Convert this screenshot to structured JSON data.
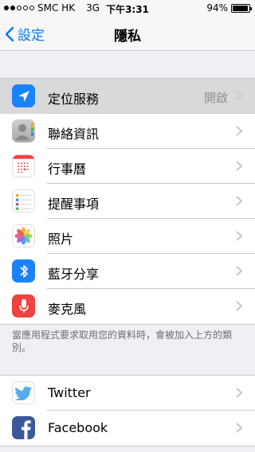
{
  "status_bar": {
    "carrier": "SMC HK",
    "network": "3G",
    "time": "下午3:31",
    "battery_text": "94%",
    "battery_level": 0.94
  },
  "nav": {
    "back_label": "設定",
    "title": "隱私"
  },
  "privacy_items": [
    {
      "label": "定位服務",
      "value": "開啟",
      "icon": "location-arrow-icon"
    },
    {
      "label": "聯絡資訊",
      "value": "",
      "icon": "contacts-icon"
    },
    {
      "label": "行事曆",
      "value": "",
      "icon": "calendar-icon"
    },
    {
      "label": "提醒事項",
      "value": "",
      "icon": "reminders-icon"
    },
    {
      "label": "照片",
      "value": "",
      "icon": "photos-icon"
    },
    {
      "label": "藍牙分享",
      "value": "",
      "icon": "bluetooth-icon"
    },
    {
      "label": "麥克風",
      "value": "",
      "icon": "microphone-icon"
    }
  ],
  "footer_note": "當應用程式要求取用您的資料時，會被加入上方的類別。",
  "social_items": [
    {
      "label": "Twitter",
      "icon": "twitter-icon"
    },
    {
      "label": "Facebook",
      "icon": "facebook-icon"
    }
  ],
  "colors": {
    "accent": "#007aff",
    "location": "#1a82fb",
    "bluetooth": "#1a82fb",
    "microphone": "#f0423f",
    "twitter": "#55acee",
    "facebook": "#3b5998"
  }
}
